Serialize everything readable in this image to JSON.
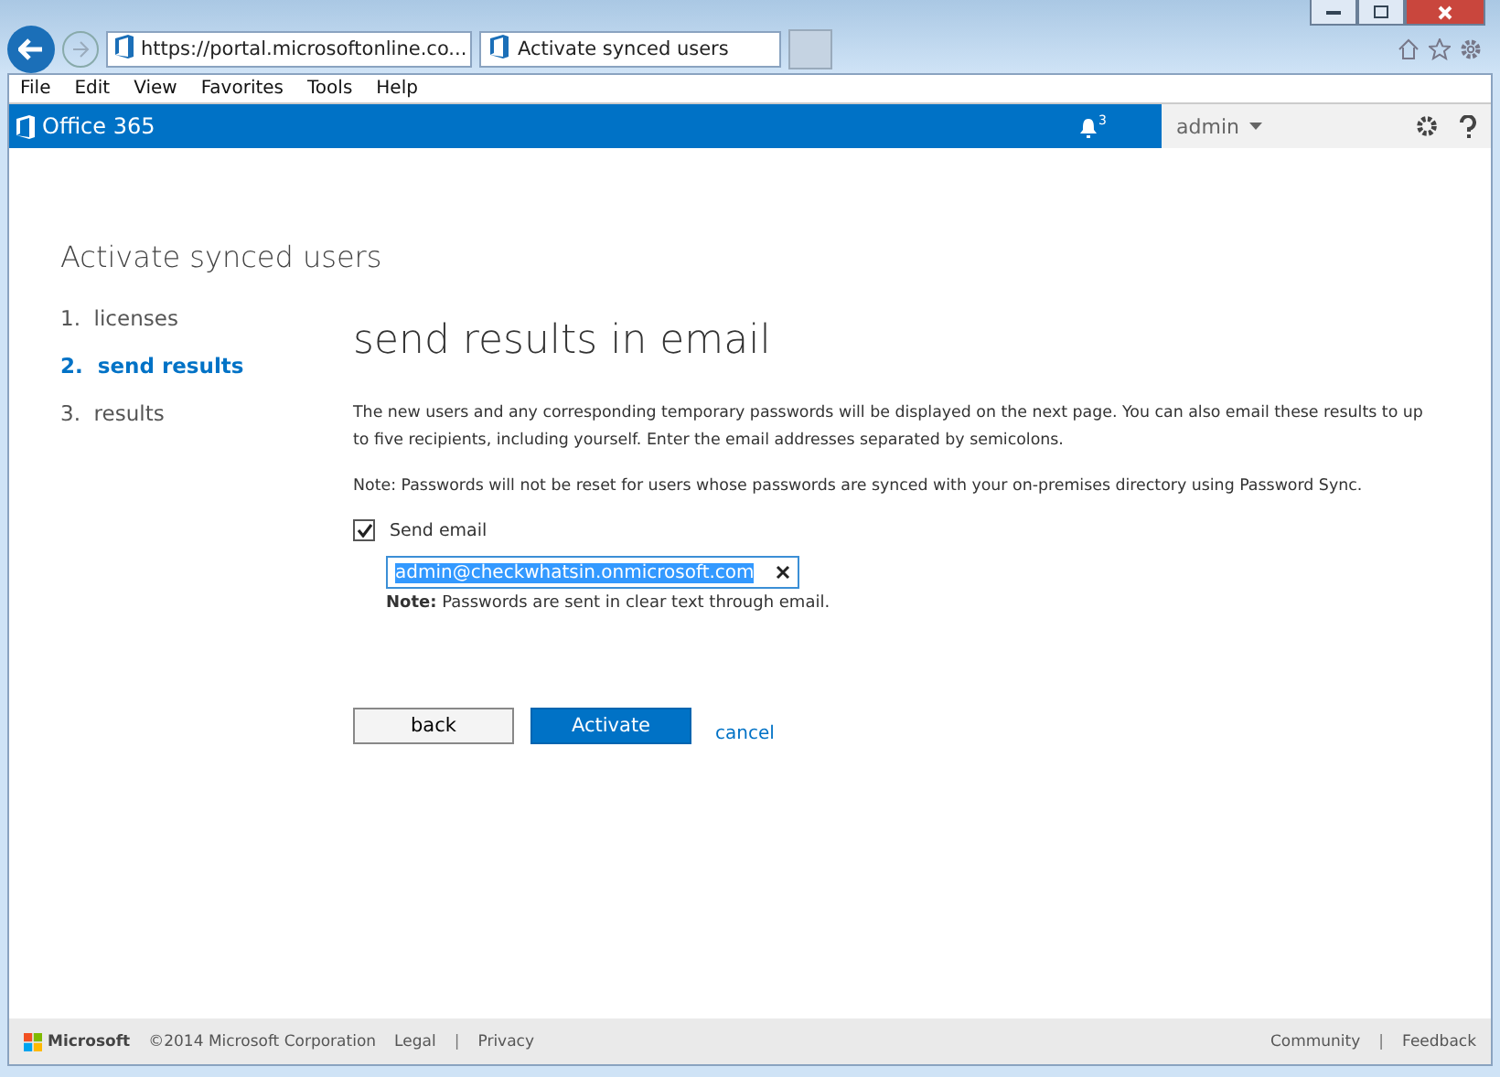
{
  "browser": {
    "url": "https://portal.microsoftonline.co...",
    "tab_title": "Activate synced users",
    "menu": [
      "File",
      "Edit",
      "View",
      "Favorites",
      "Tools",
      "Help"
    ]
  },
  "header": {
    "brand": "Office 365",
    "notification_count": "3",
    "user": "admin"
  },
  "wizard": {
    "title": "Activate synced users",
    "steps": [
      {
        "number": "1.",
        "label": "licenses",
        "selected": false
      },
      {
        "number": "2.",
        "label": "send results",
        "selected": true
      },
      {
        "number": "3.",
        "label": "results",
        "selected": false
      }
    ],
    "heading": "send results in email",
    "paragraphs": [
      "The new users and any corresponding temporary passwords will be displayed on the next page. You can also email these results to up to five recipients, including yourself. Enter the email addresses separated by semicolons.",
      "Note: Passwords will not be reset for users whose passwords are synced with your on-premises directory using Password Sync."
    ],
    "send_email": {
      "label": "Send email",
      "checked": true
    },
    "email": {
      "value": "admin@checkwhatsin.onmicrosoft.com"
    },
    "email_note": "**Note:** Passwords are sent in clear text through email.",
    "buttons": {
      "back": "back",
      "activate": "Activate",
      "cancel": "cancel"
    }
  },
  "footer": {
    "separator": "|",
    "brand": "Microsoft",
    "copyright": "©2014 Microsoft Corporation",
    "left_links": [
      "Legal",
      "Privacy"
    ],
    "right_links": [
      "Community",
      "Feedback"
    ]
  }
}
